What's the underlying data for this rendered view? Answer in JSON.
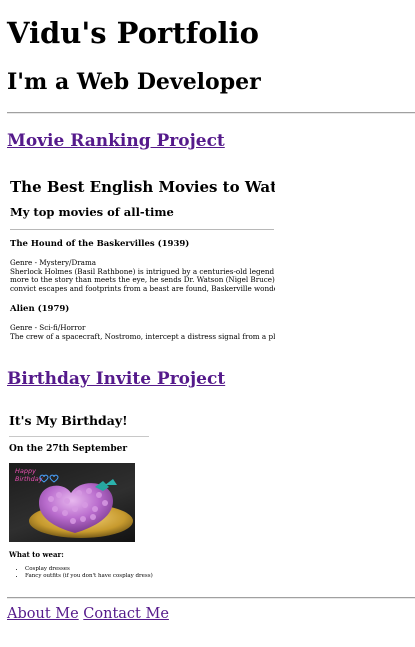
{
  "site": {
    "title": "Vidu's Portfolio",
    "subtitle": "I'm a Web Developer"
  },
  "projects": [
    {
      "link_text": "Movie Ranking Project",
      "preview": {
        "title": "The Best English Movies to Watch",
        "subtitle": "My top movies of all-time",
        "movies": [
          {
            "heading": "The Hound of the Baskervilles (1939)",
            "genre": "Genre - Mystery/Drama",
            "description": [
              "Sherlock Holmes (Basil Rathbone) is intrigued by a centuries-old legend in which every",
              "more to the story than meets the eye, he sends Dr. Watson (Nigel Bruce) to the estate",
              "convict escapes and footprints from a beast are found, Baskerville wonders if Watson"
            ]
          },
          {
            "heading": "Alien (1979)",
            "genre": "Genre - Sci-fi/Horror",
            "description": [
              "The crew of a spacecraft, Nostromo, intercept a distress signal from a planet and set"
            ]
          }
        ]
      }
    },
    {
      "link_text": "Birthday Invite Project",
      "preview": {
        "title": "It's My Birthday!",
        "date": "On the 27th September",
        "image_text": [
          "Happy",
          "Birthday"
        ],
        "wear_heading": "What to wear:",
        "wear_items": [
          "Cosplay dresses",
          "Fancy outfits (if you don't have cosplay dress)"
        ]
      }
    }
  ],
  "footer": {
    "links": [
      "About Me",
      "Contact Me"
    ]
  },
  "colors": {
    "visited_link": "#551a8b",
    "cake_pink": "#e64fb0",
    "heart_blue": "#4aa3ff"
  }
}
